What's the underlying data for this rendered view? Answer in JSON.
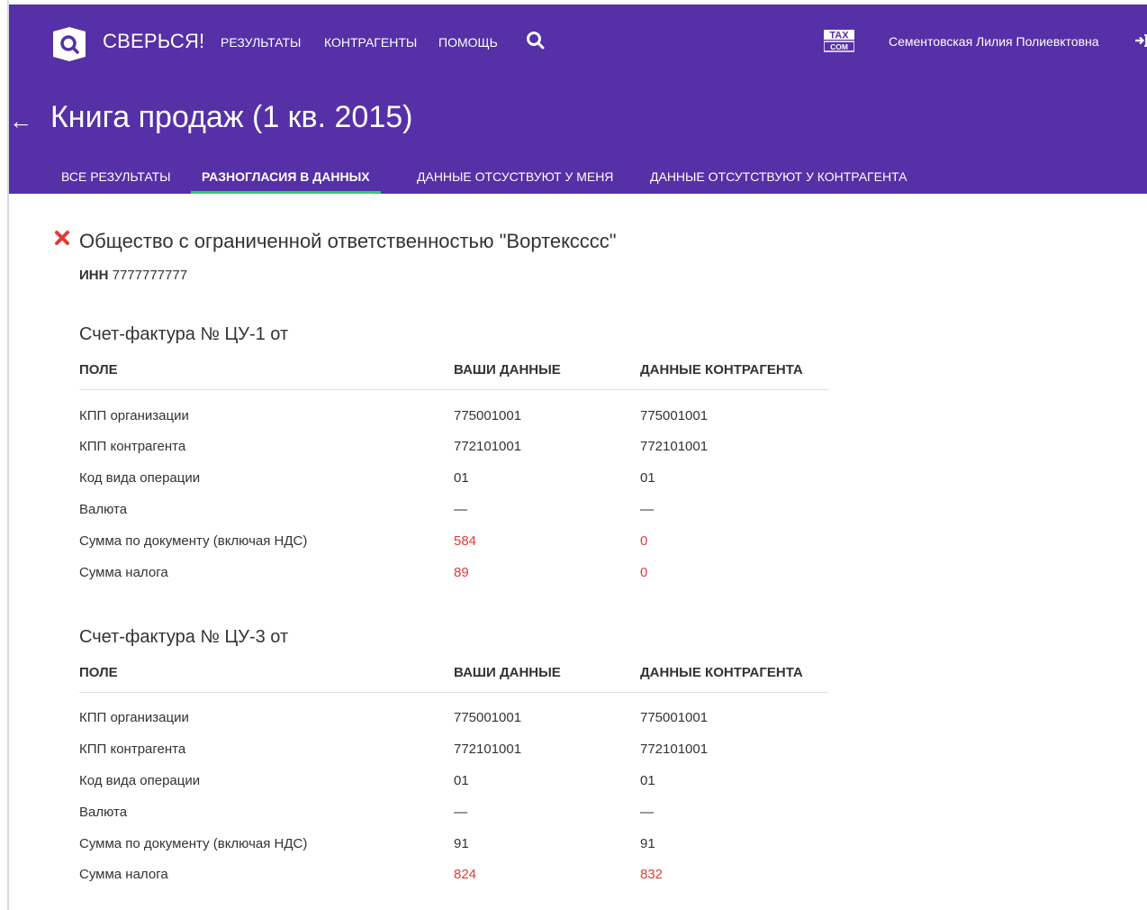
{
  "app": {
    "brand": "СВЕРЬСЯ!",
    "nav": [
      "РЕЗУЛЬТАТЫ",
      "КОНТРАГЕНТЫ",
      "ПОМОЩЬ"
    ],
    "user_name": "Сементовская Лилия Полиевктовна",
    "icons": [
      "logo-icon",
      "search-icon",
      "taxcom-logo",
      "logout-icon",
      "back-arrow-icon",
      "error-x-icon"
    ]
  },
  "page": {
    "title": "Книга продаж (1 кв. 2015)",
    "back": "←",
    "tabs": [
      {
        "label": "ВСЕ РЕЗУЛЬТАТЫ",
        "active": false
      },
      {
        "label": "РАЗНОГЛАСИЯ В ДАННЫХ",
        "active": true
      },
      {
        "label": "ДАННЫЕ ОТСУСТВУЮТ У МЕНЯ",
        "active": false
      },
      {
        "label": "ДАННЫЕ ОТСУТСТВУЮТ У КОНТРАГЕНТА",
        "active": false
      }
    ]
  },
  "organization": {
    "name": "Общество с ограниченной ответственностью \"Вортекcccc\"",
    "inn_label": "ИНН",
    "inn_value": "7777777777"
  },
  "columns": {
    "field": "ПОЛЕ",
    "yours": "ВАШИ ДАННЫЕ",
    "counterparty": "ДАННЫЕ КОНТРАГЕНТА"
  },
  "invoices": [
    {
      "title": "Счет-фактура № ЦУ-1 от",
      "rows": [
        {
          "field": "КПП организации",
          "yours": "775001001",
          "counterparty": "775001001",
          "diff": false
        },
        {
          "field": "КПП контрагента",
          "yours": "772101001",
          "counterparty": "772101001",
          "diff": false
        },
        {
          "field": "Код вида операции",
          "yours": "01",
          "counterparty": "01",
          "diff": false
        },
        {
          "field": "Валюта",
          "yours": "—",
          "counterparty": "—",
          "diff": false
        },
        {
          "field": "Сумма по документу (включая НДС)",
          "yours": "584",
          "counterparty": "0",
          "diff": true
        },
        {
          "field": "Сумма налога",
          "yours": "89",
          "counterparty": "0",
          "diff": true
        }
      ]
    },
    {
      "title": "Счет-фактура № ЦУ-3 от",
      "rows": [
        {
          "field": "КПП организации",
          "yours": "775001001",
          "counterparty": "775001001",
          "diff": false
        },
        {
          "field": "КПП контрагента",
          "yours": "772101001",
          "counterparty": "772101001",
          "diff": false
        },
        {
          "field": "Код вида операции",
          "yours": "01",
          "counterparty": "01",
          "diff": false
        },
        {
          "field": "Валюта",
          "yours": "—",
          "counterparty": "—",
          "diff": false
        },
        {
          "field": "Сумма по документу (включая НДС)",
          "yours": "91",
          "counterparty": "91",
          "diff": false
        },
        {
          "field": "Сумма налога",
          "yours": "824",
          "counterparty": "832",
          "diff": true
        }
      ]
    }
  ],
  "colors": {
    "header_bg": "#5530a6",
    "tab_active_underline": "#2ecc71",
    "error_red": "#e53935",
    "diff_red": "#e53935"
  }
}
